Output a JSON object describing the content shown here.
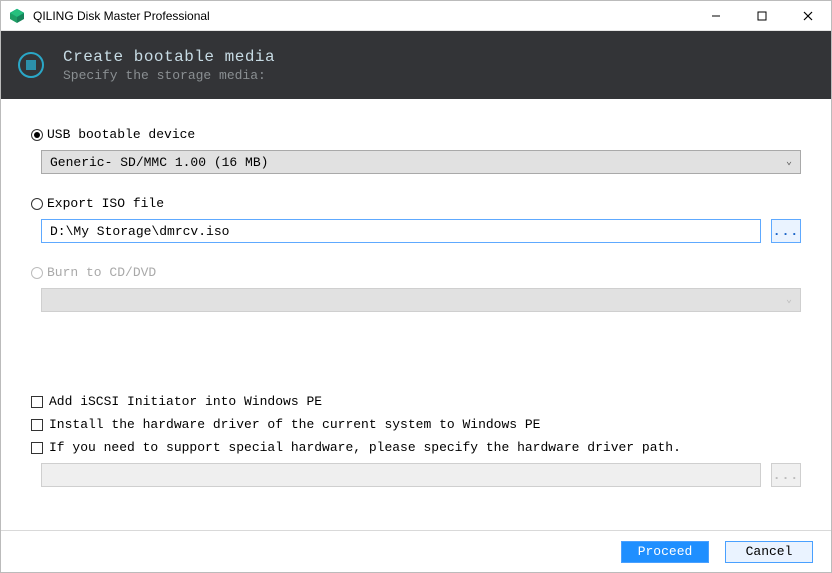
{
  "window": {
    "title": "QILING Disk Master Professional"
  },
  "header": {
    "title": "Create bootable media",
    "subtitle": "Specify the storage media:"
  },
  "options": {
    "usb": {
      "label": "USB bootable device",
      "device": "Generic- SD/MMC 1.00 (16 MB)"
    },
    "iso": {
      "label": "Export ISO file",
      "path": "D:\\My Storage\\dmrcv.iso",
      "browse": "..."
    },
    "cddvd": {
      "label": "Burn to CD/DVD"
    }
  },
  "checks": {
    "iscsi": "Add iSCSI Initiator into Windows PE",
    "driver_current": "Install the hardware driver of the current system to Windows PE",
    "driver_special": "If you need to support special hardware, please specify the hardware driver path.",
    "driver_browse": "..."
  },
  "footer": {
    "proceed": "Proceed",
    "cancel": "Cancel"
  }
}
